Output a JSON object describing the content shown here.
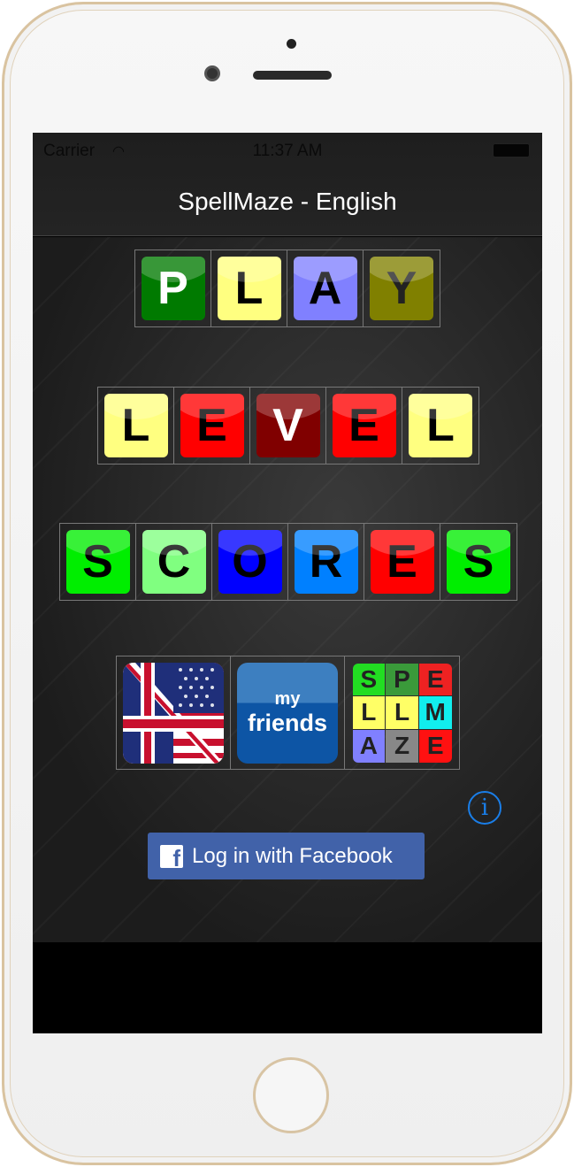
{
  "status_bar": {
    "carrier": "Carrier",
    "time": "11:37 AM"
  },
  "nav": {
    "title": "SpellMaze - English"
  },
  "menu": [
    {
      "id": "play",
      "tiles": [
        {
          "l": "P",
          "bg": "#007a00",
          "fg": "#ffffff"
        },
        {
          "l": "L",
          "bg": "#ffff80",
          "fg": "#000000"
        },
        {
          "l": "A",
          "bg": "#8080ff",
          "fg": "#000000"
        },
        {
          "l": "Y",
          "bg": "#808000",
          "fg": "#222222"
        }
      ]
    },
    {
      "id": "level",
      "tiles": [
        {
          "l": "L",
          "bg": "#ffff80",
          "fg": "#000000"
        },
        {
          "l": "E",
          "bg": "#ff0000",
          "fg": "#000000"
        },
        {
          "l": "V",
          "bg": "#800000",
          "fg": "#ffffff"
        },
        {
          "l": "E",
          "bg": "#ff0000",
          "fg": "#000000"
        },
        {
          "l": "L",
          "bg": "#ffff80",
          "fg": "#000000"
        }
      ]
    },
    {
      "id": "scores",
      "tiles": [
        {
          "l": "S",
          "bg": "#00ee00",
          "fg": "#000000"
        },
        {
          "l": "C",
          "bg": "#80ff80",
          "fg": "#000000"
        },
        {
          "l": "O",
          "bg": "#0000ff",
          "fg": "#000000"
        },
        {
          "l": "R",
          "bg": "#0080ff",
          "fg": "#000000"
        },
        {
          "l": "E",
          "bg": "#ff0000",
          "fg": "#000000"
        },
        {
          "l": "S",
          "bg": "#00ee00",
          "fg": "#000000"
        }
      ]
    }
  ],
  "icons": {
    "language_icon": "uk-us-flag-icon",
    "friends": {
      "my": "my",
      "friends": "friends"
    },
    "logo": [
      {
        "l": "S",
        "bg": "#22dd22"
      },
      {
        "l": "P",
        "bg": "#3a9a3a"
      },
      {
        "l": "E",
        "bg": "#ee2222"
      },
      {
        "l": "L",
        "bg": "#ffff66"
      },
      {
        "l": "L",
        "bg": "#ffff66"
      },
      {
        "l": "M",
        "bg": "#11eeee"
      },
      {
        "l": "A",
        "bg": "#8080ff"
      },
      {
        "l": "Z",
        "bg": "#888888"
      },
      {
        "l": "E",
        "bg": "#ff1111"
      }
    ]
  },
  "info_icon": "i",
  "facebook": {
    "label": "Log in with Facebook",
    "icon": "f",
    "color": "#4162a9"
  }
}
